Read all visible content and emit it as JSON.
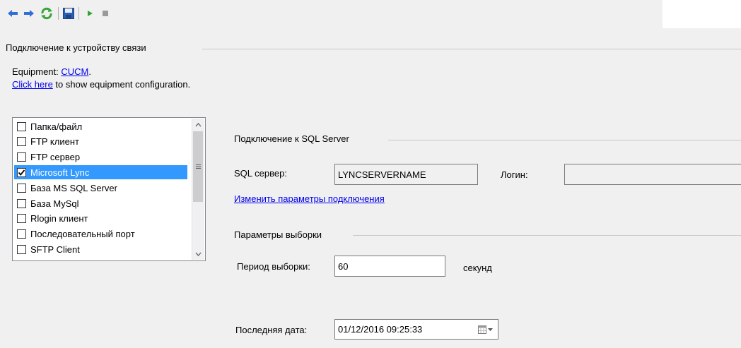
{
  "toolbar": {
    "icons": [
      "back-arrow-icon",
      "forward-arrow-icon",
      "refresh-icon",
      "save-icon",
      "play-icon",
      "stop-icon"
    ]
  },
  "connection_group": {
    "title": "Подключение к устройству связи"
  },
  "equipment": {
    "prefix": "Equipment: ",
    "name": "CUCM",
    "suffix": ".",
    "config_link": "Click here",
    "config_text": " to show equipment configuration."
  },
  "connection_types": [
    {
      "label": "Папка/файл",
      "checked": false,
      "selected": false
    },
    {
      "label": "FTP клиент",
      "checked": false,
      "selected": false
    },
    {
      "label": "FTP сервер",
      "checked": false,
      "selected": false
    },
    {
      "label": "Microsoft Lync",
      "checked": true,
      "selected": true
    },
    {
      "label": "База MS SQL Server",
      "checked": false,
      "selected": false
    },
    {
      "label": "База MySql",
      "checked": false,
      "selected": false
    },
    {
      "label": "Rlogin клиент",
      "checked": false,
      "selected": false
    },
    {
      "label": "Последовательный порт",
      "checked": false,
      "selected": false
    },
    {
      "label": "SFTP Client",
      "checked": false,
      "selected": false
    }
  ],
  "sql_group": {
    "title": "Подключение к SQL Server",
    "server_label": "SQL сервер:",
    "server_value": "LYNCSERVERNAME",
    "login_label": "Логин:",
    "login_value": "",
    "change_link": "Изменить параметры подключения"
  },
  "sampling_group": {
    "title": "Параметры выборки",
    "period_label": "Период выборки:",
    "period_value": "60",
    "period_unit": "секунд",
    "last_date_label": "Последняя дата:",
    "last_date_value": "01/12/2016 09:25:33"
  },
  "colors": {
    "selection": "#3399ff",
    "link": "#0000ee",
    "background": "#f0f0f0"
  }
}
